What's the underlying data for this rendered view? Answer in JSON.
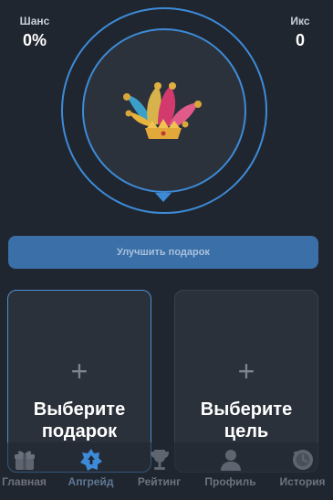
{
  "stats": {
    "chance_label": "Шанс",
    "chance_value": "0%",
    "multiplier_label": "Икс",
    "multiplier_value": "0"
  },
  "wheel": {
    "center_icon": "jester-hat-icon"
  },
  "upgrade_button_label": "Улучшить подарок",
  "cards": {
    "gift": {
      "plus": "+",
      "line1": "Выберите",
      "line2": "подарок"
    },
    "target": {
      "plus": "+",
      "line1": "Выберите",
      "line2": "цель"
    }
  },
  "nav": {
    "active": "upgrade",
    "items": [
      {
        "label": "Главная",
        "icon": "gift-icon"
      },
      {
        "label": "Апгрейд",
        "icon": "upgrade-star-icon"
      },
      {
        "label": "Рейтинг",
        "icon": "trophy-icon"
      },
      {
        "label": "Профиль",
        "icon": "profile-icon"
      },
      {
        "label": "История",
        "icon": "history-clock-icon"
      }
    ]
  },
  "colors": {
    "background": "#20262f",
    "accent": "#3d8bd8",
    "button": "#3a6fa8",
    "card": "#2b313a",
    "nav_inactive": "#6c737e"
  }
}
